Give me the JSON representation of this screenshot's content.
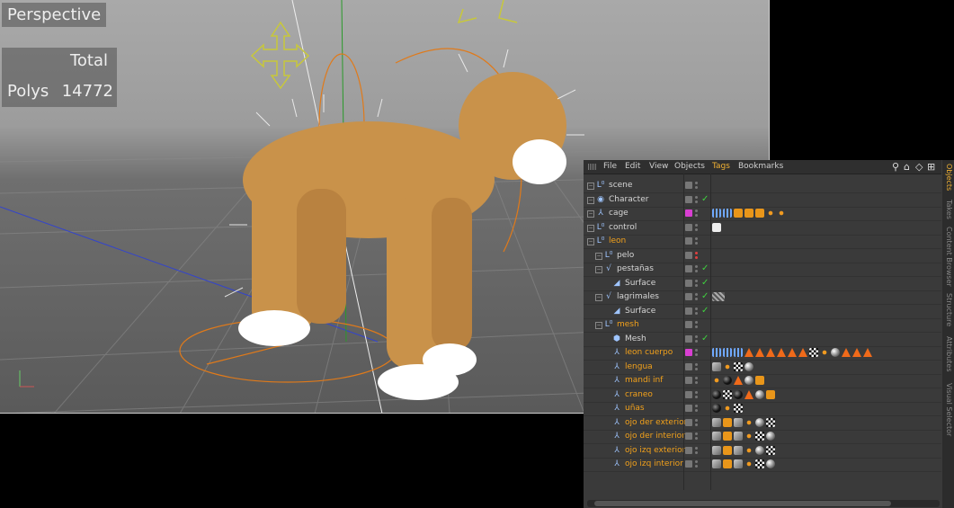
{
  "viewport": {
    "title": "Perspective",
    "hud": {
      "total_label": "Total",
      "polys_label": "Polys",
      "polys_value": "14772"
    }
  },
  "object_manager": {
    "menu": [
      "File",
      "Edit",
      "View",
      "Objects",
      "Tags",
      "Bookmarks"
    ],
    "active_menu": "Tags",
    "toolbar_icons": [
      "search-icon",
      "home-icon",
      "view-icon",
      "new-window-icon"
    ],
    "rows": [
      {
        "name": "scene",
        "color": "white",
        "icon": "null-icon",
        "indent": 0,
        "vis": "grey",
        "check": false
      },
      {
        "name": "Character",
        "color": "white",
        "icon": "character-icon",
        "indent": 0,
        "vis": "grey",
        "check": true
      },
      {
        "name": "cage",
        "color": "white",
        "icon": "joint-icon",
        "indent": 0,
        "vis": "pink",
        "check": false
      },
      {
        "name": "control",
        "color": "white",
        "icon": "null-icon",
        "indent": 0,
        "vis": "grey",
        "check": false
      },
      {
        "name": "leon",
        "color": "orange",
        "icon": "null-icon",
        "indent": 0,
        "vis": "grey",
        "check": false
      },
      {
        "name": "pelo",
        "color": "white",
        "icon": "null-icon",
        "indent": 1,
        "vis": "grey",
        "check": false,
        "red": true
      },
      {
        "name": "pestañas",
        "color": "white",
        "icon": "spline-icon",
        "indent": 1,
        "vis": "grey",
        "check": true
      },
      {
        "name": "Surface",
        "color": "white",
        "icon": "surface-icon",
        "indent": 2,
        "vis": "grey",
        "check": true
      },
      {
        "name": "lagrimales",
        "color": "white",
        "icon": "spline-icon",
        "indent": 1,
        "vis": "grey",
        "check": true
      },
      {
        "name": "Surface",
        "color": "white",
        "icon": "surface-icon",
        "indent": 2,
        "vis": "grey",
        "check": true
      },
      {
        "name": "mesh",
        "color": "orange",
        "icon": "null-icon",
        "indent": 1,
        "vis": "grey",
        "check": false
      },
      {
        "name": "Mesh",
        "color": "white",
        "icon": "mesh-icon",
        "indent": 2,
        "vis": "grey",
        "check": true
      },
      {
        "name": "leon cuerpo",
        "color": "orange",
        "icon": "polygon-icon",
        "indent": 2,
        "vis": "pink",
        "check": false
      },
      {
        "name": "lengua",
        "color": "orange",
        "icon": "polygon-icon",
        "indent": 2,
        "vis": "grey",
        "check": false
      },
      {
        "name": "mandi inf",
        "color": "orange",
        "icon": "polygon-icon",
        "indent": 2,
        "vis": "grey",
        "check": false
      },
      {
        "name": "craneo",
        "color": "orange",
        "icon": "polygon-icon",
        "indent": 2,
        "vis": "grey",
        "check": false
      },
      {
        "name": "uñas",
        "color": "orange",
        "icon": "polygon-icon",
        "indent": 2,
        "vis": "grey",
        "check": false
      },
      {
        "name": "ojo der exterior",
        "color": "orange",
        "icon": "polygon-icon",
        "indent": 2,
        "vis": "grey",
        "check": false
      },
      {
        "name": "ojo der interior",
        "color": "orange",
        "icon": "polygon-icon",
        "indent": 2,
        "vis": "grey",
        "check": false
      },
      {
        "name": "ojo izq exterior",
        "color": "orange",
        "icon": "polygon-icon",
        "indent": 2,
        "vis": "grey",
        "check": false
      },
      {
        "name": "ojo izq interior",
        "color": "orange",
        "icon": "polygon-icon",
        "indent": 2,
        "vis": "grey",
        "check": false
      }
    ],
    "tags": [
      [],
      [],
      [
        "blue",
        "blue",
        "orange",
        "orange",
        "orange",
        "dot",
        "dot"
      ],
      [
        "redx"
      ],
      [],
      [],
      [],
      [],
      [
        "hatch"
      ],
      [],
      [],
      [],
      [
        "blue",
        "blue",
        "blue",
        "tri",
        "tri",
        "tri",
        "tri",
        "tri",
        "tri",
        "checker",
        "dot",
        "sphere",
        "tri",
        "tri",
        "tri"
      ],
      [
        "bone",
        "dot",
        "checker",
        "sphere"
      ],
      [
        "dot",
        "blackball",
        "tri",
        "sphere",
        "orange"
      ],
      [
        "blackball",
        "checker",
        "blackball",
        "tri",
        "sphere",
        "orange"
      ],
      [
        "blackball",
        "dot",
        "checker"
      ],
      [
        "bone",
        "orange",
        "bone",
        "dot",
        "sphere",
        "checker"
      ],
      [
        "bone",
        "orange",
        "bone",
        "dot",
        "checker",
        "sphere"
      ],
      [
        "bone",
        "orange",
        "bone",
        "dot",
        "sphere",
        "checker"
      ],
      [
        "bone",
        "orange",
        "bone",
        "dot",
        "checker",
        "sphere"
      ]
    ],
    "side_tabs": [
      "Objects",
      "Takes",
      "Content Browser",
      "Structure",
      "Attributes",
      "Visual Selector"
    ],
    "active_side_tab": "Objects"
  }
}
